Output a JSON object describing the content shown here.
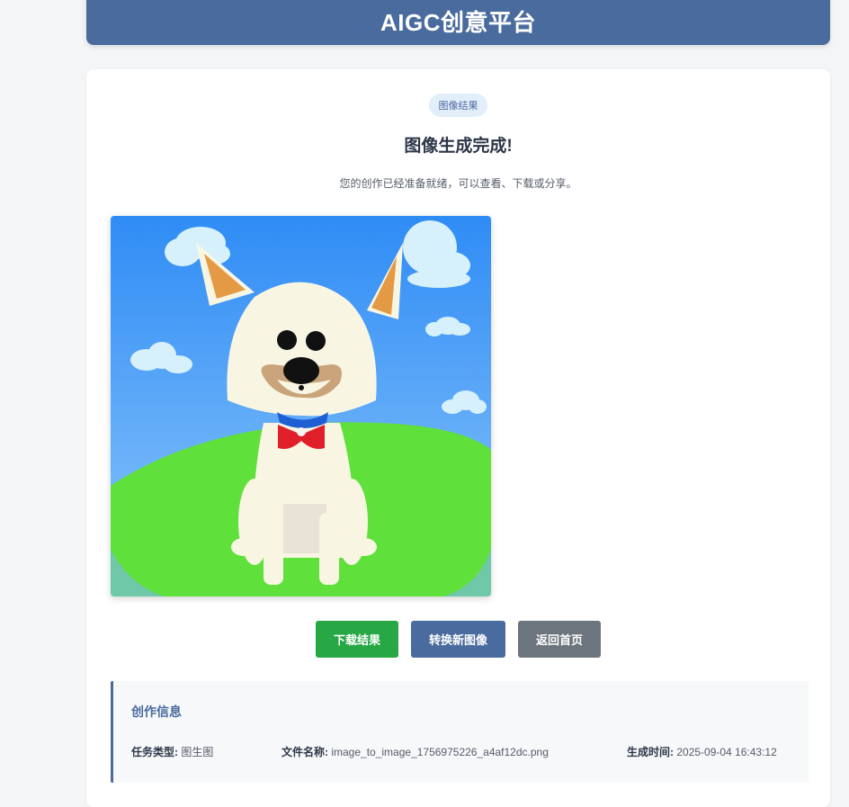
{
  "header": {
    "title": "AIGC创意平台"
  },
  "result": {
    "badge": "图像结果",
    "title": "图像生成完成!",
    "subtitle": "您的创作已经准备就绪，可以查看、下载或分享。"
  },
  "image": {
    "subject": "cartoon white dog sitting on green hill under blue sky"
  },
  "buttons": {
    "download": "下载结果",
    "convert": "转换新图像",
    "home": "返回首页"
  },
  "info": {
    "title": "创作信息",
    "task_type_label": "任务类型:",
    "task_type_value": "图生图",
    "file_name_label": "文件名称:",
    "file_name_value": "image_to_image_1756975226_a4af12dc.png",
    "time_label": "生成时间:",
    "time_value": "2025-09-04 16:43:12"
  },
  "colors": {
    "primary": "#4a6b9e",
    "success": "#28a745",
    "secondary": "#6c757d"
  }
}
